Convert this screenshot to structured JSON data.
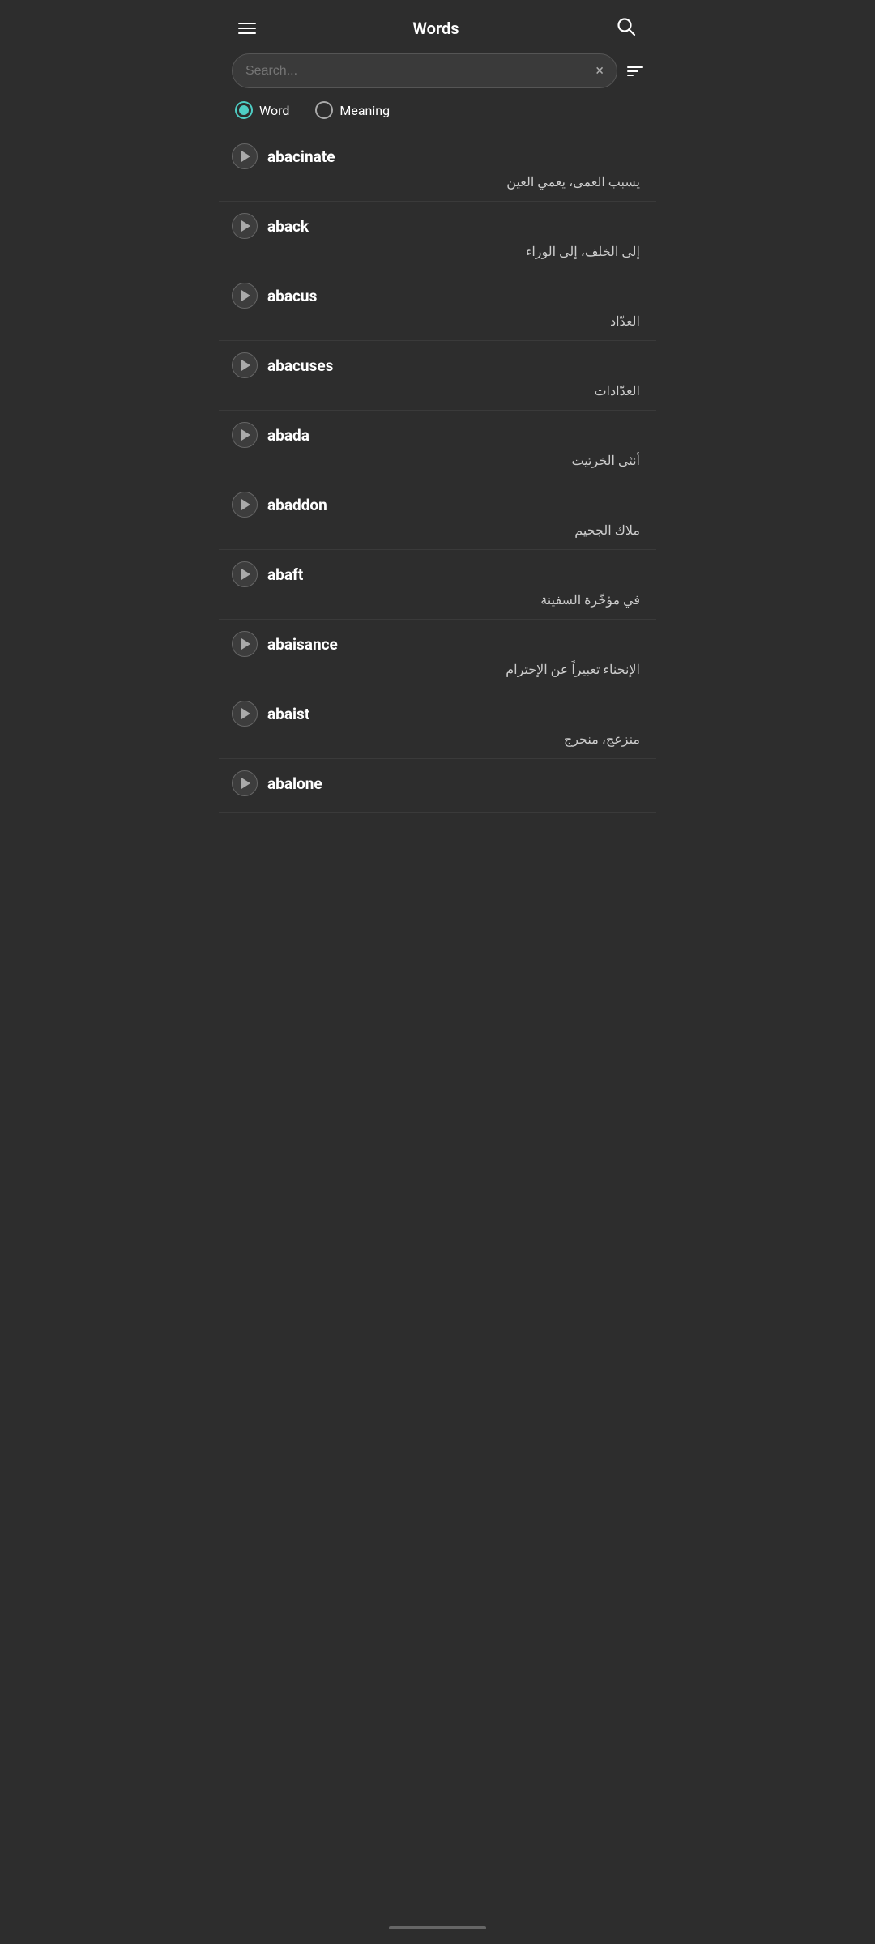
{
  "header": {
    "title": "Words",
    "menu_icon": "menu",
    "search_icon": "search"
  },
  "search": {
    "placeholder": "Search...",
    "clear_label": "×",
    "filter_label": "filter"
  },
  "radio": {
    "options": [
      {
        "label": "Word",
        "active": true
      },
      {
        "label": "Meaning",
        "active": false
      }
    ]
  },
  "words": [
    {
      "word": "abacinate",
      "meaning": "يسبب العمى، يعمي العين"
    },
    {
      "word": "aback",
      "meaning": "إلى الخلف، إلى الوراء"
    },
    {
      "word": "abacus",
      "meaning": "العدّاد"
    },
    {
      "word": "abacuses",
      "meaning": "العدّادات"
    },
    {
      "word": "abada",
      "meaning": "أنثى الخرتيت"
    },
    {
      "word": "abaddon",
      "meaning": "ملاك الجحيم"
    },
    {
      "word": "abaft",
      "meaning": "في مؤخّرة السفينة"
    },
    {
      "word": "abaisance",
      "meaning": "الإنحناء تعبيراً عن الإحترام"
    },
    {
      "word": "abaist",
      "meaning": "منزعج، منحرج"
    },
    {
      "word": "abalone",
      "meaning": ""
    }
  ]
}
